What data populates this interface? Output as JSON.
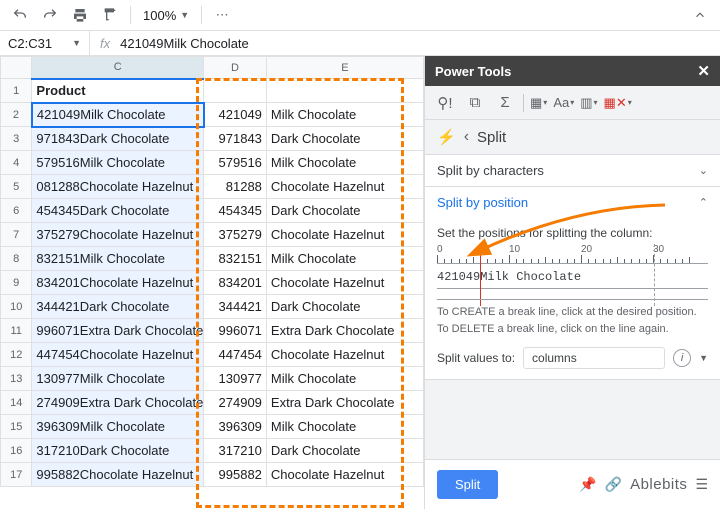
{
  "toolbar": {
    "zoom": "100%"
  },
  "formula": {
    "ref": "C2:C31",
    "fx": "fx",
    "value": "421049Milk Chocolate"
  },
  "sheet": {
    "columns": [
      "",
      "C",
      "D",
      "E"
    ],
    "header_row": {
      "c": "Product"
    },
    "rows": [
      {
        "n": 2,
        "c": "421049Milk Chocolate",
        "d": "421049",
        "e": "Milk Chocolate"
      },
      {
        "n": 3,
        "c": "971843Dark Chocolate",
        "d": "971843",
        "e": "Dark Chocolate"
      },
      {
        "n": 4,
        "c": "579516Milk Chocolate",
        "d": "579516",
        "e": "Milk Chocolate"
      },
      {
        "n": 5,
        "c": "081288Chocolate Hazelnut",
        "d": "81288",
        "e": "Chocolate Hazelnut"
      },
      {
        "n": 6,
        "c": "454345Dark Chocolate",
        "d": "454345",
        "e": "Dark Chocolate"
      },
      {
        "n": 7,
        "c": "375279Chocolate Hazelnut",
        "d": "375279",
        "e": "Chocolate Hazelnut"
      },
      {
        "n": 8,
        "c": "832151Milk Chocolate",
        "d": "832151",
        "e": "Milk Chocolate"
      },
      {
        "n": 9,
        "c": "834201Chocolate Hazelnut",
        "d": "834201",
        "e": "Chocolate Hazelnut"
      },
      {
        "n": 10,
        "c": "344421Dark Chocolate",
        "d": "344421",
        "e": "Dark Chocolate"
      },
      {
        "n": 11,
        "c": "996071Extra Dark Chocolate",
        "d": "996071",
        "e": "Extra Dark Chocolate"
      },
      {
        "n": 12,
        "c": "447454Chocolate Hazelnut",
        "d": "447454",
        "e": "Chocolate Hazelnut"
      },
      {
        "n": 13,
        "c": "130977Milk Chocolate",
        "d": "130977",
        "e": "Milk Chocolate"
      },
      {
        "n": 14,
        "c": "274909Extra Dark Chocolate",
        "d": "274909",
        "e": "Extra Dark Chocolate"
      },
      {
        "n": 15,
        "c": "396309Milk Chocolate",
        "d": "396309",
        "e": "Milk Chocolate"
      },
      {
        "n": 16,
        "c": "317210Dark Chocolate",
        "d": "317210",
        "e": "Dark Chocolate"
      },
      {
        "n": 17,
        "c": "995882Chocolate Hazelnut",
        "d": "995882",
        "e": "Chocolate Hazelnut"
      }
    ]
  },
  "panel": {
    "title": "Power Tools",
    "crumb_back": "‹",
    "crumb_title": "Split",
    "sections": {
      "by_chars": "Split by characters",
      "by_pos": "Split by position",
      "instr": "Set the positions for splitting the column:",
      "preview_text": "421049Milk Chocolate",
      "hint1": "To CREATE a break line, click at the desired position.",
      "hint2": "To DELETE a break line, click on the line again.",
      "split_to_label": "Split values to:",
      "split_to_value": "columns"
    },
    "ruler_ticks": [
      "0",
      "10",
      "20",
      "30"
    ],
    "button": "Split",
    "brand": "Ablebits"
  }
}
